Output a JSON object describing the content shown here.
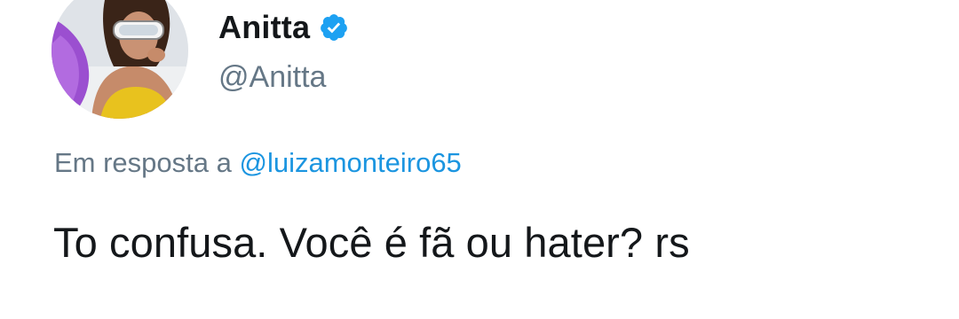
{
  "tweet": {
    "author": {
      "display_name": "Anitta",
      "handle": "@Anitta",
      "verified_icon": "verified-badge-icon",
      "avatar_icon": "profile-photo"
    },
    "reply_prefix": "Em resposta a ",
    "reply_to": "@luizamonteiro65",
    "text": "To confusa. Você é fã ou hater? rs"
  },
  "colors": {
    "text_primary": "#14171a",
    "text_secondary": "#657786",
    "link": "#1b95e0",
    "verified": "#1da1f2",
    "background": "#ffffff"
  }
}
